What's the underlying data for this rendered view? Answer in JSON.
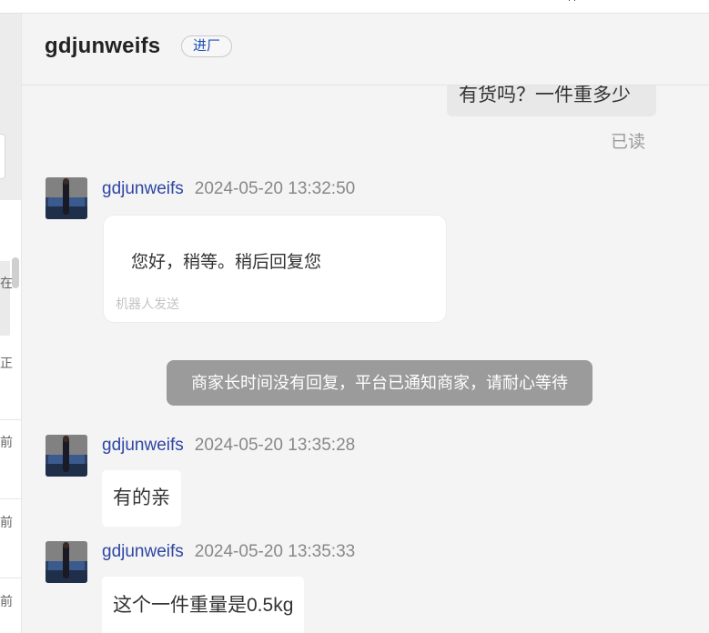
{
  "header": {
    "name": "gdjunweifs",
    "tag": "进厂"
  },
  "left_panel": {
    "fragments": [
      "在",
      "正",
      "前",
      "前",
      "前"
    ]
  },
  "messages": {
    "outgoing_text": "有货吗？一件重多少",
    "read_status": "已读",
    "items": [
      {
        "sender": "gdjunweifs",
        "time": "2024-05-20 13:32:50",
        "text": "您好，稍等。稍后回复您",
        "note": "机器人发送"
      },
      {
        "sender": "gdjunweifs",
        "time": "2024-05-20 13:35:28",
        "text": "有的亲"
      },
      {
        "sender": "gdjunweifs",
        "time": "2024-05-20 13:35:33",
        "text": "这个一件重量是0.5kg"
      }
    ],
    "system_notice": "商家长时间没有回复，平台已通知商家，请耐心等待"
  },
  "colors": {
    "sender_name": "#2d46a3",
    "tag_text": "#1f4fb6",
    "notice_bg": "#9b9b9b"
  },
  "icons": {
    "avatar": "avatar-photo"
  }
}
